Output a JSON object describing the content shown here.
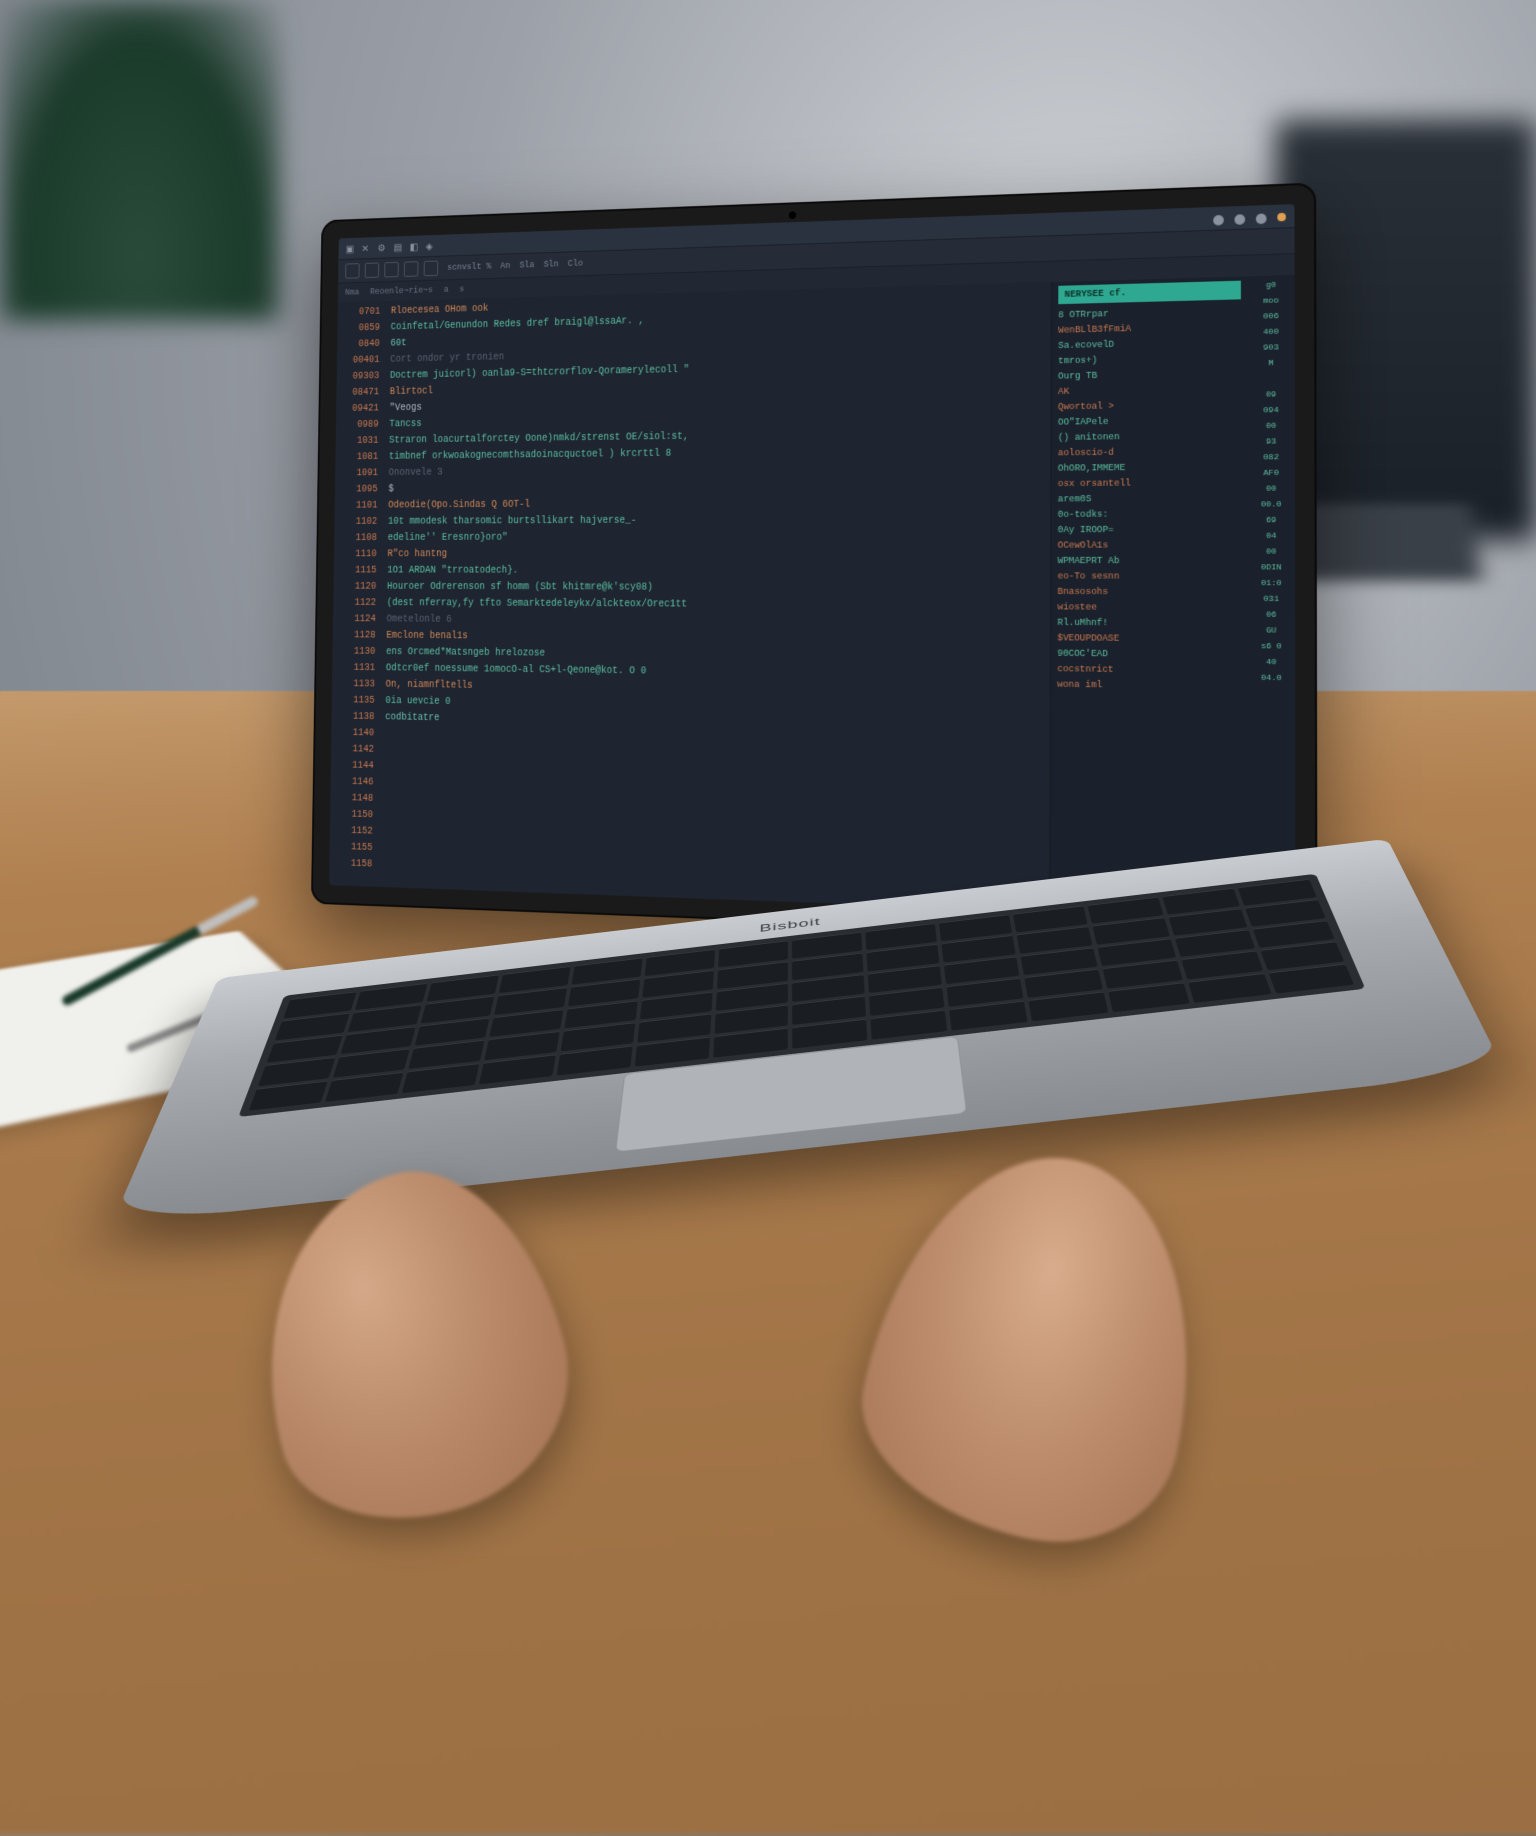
{
  "brand": "Bisboit",
  "titlebar": {
    "icons": [
      "▣",
      "✕",
      "⚙",
      "▤",
      "◧",
      "◈"
    ]
  },
  "toolbar": {
    "buttons": [
      "□",
      "□",
      "□",
      "◫",
      "▭"
    ],
    "label": "scnvslt %",
    "menu": [
      "An",
      "Sla",
      "Sln",
      "Clo"
    ]
  },
  "tabs": [
    "Nma",
    "Reoenle~rie~s",
    "a",
    "s"
  ],
  "gutter": [
    "0701",
    "0859",
    "0840",
    "00401",
    "09303",
    "08471",
    "09421",
    "0989",
    "1031",
    "1081",
    "1091",
    "1095",
    "1101",
    "1102",
    "1108",
    "1110",
    "1115",
    "1120",
    "1122",
    "1124",
    "1128",
    "1130",
    "1131",
    "1133",
    "1135",
    "1138",
    "1140",
    "1142",
    "1144",
    "1146",
    "1148",
    "1150",
    "1152",
    "1155",
    "1158"
  ],
  "code": [
    {
      "t": "Rloecesea OHom ook",
      "c": "kw"
    },
    {
      "t": "Coinfetal/Genundon  Redes dref braigl@lssaAr. ,",
      "c": "str"
    },
    {
      "t": "60t",
      "c": "fn"
    },
    {
      "t": "Cort ondor yr tronien",
      "c": "cm"
    },
    {
      "t": "Doctrem juicorl) oanla9-S=thtcrorflov-Qoramerylecoll \"",
      "c": "str"
    },
    {
      "t": "Blirtocl",
      "c": "kw"
    },
    {
      "t": "  \"Veogs",
      "c": "pl"
    },
    {
      "t": "Tancss",
      "c": "str"
    },
    {
      "t": "Straron loacurtalforctey Oone)nmkd/strenst OE/siol:st,",
      "c": "str"
    },
    {
      "t": "timbnef orkwoakognecomthsadoinacquctoel )   krcrttl 8",
      "c": "str"
    },
    {
      "t": "  Ononvele 3",
      "c": "cm"
    },
    {
      "t": "          $",
      "c": "pl"
    },
    {
      "t": "Odeodie(Opo.Sindas  Q  6OT-l",
      "c": "kw"
    },
    {
      "t": "10t mmodesk tharsomic burtsllikart hajverse_-",
      "c": "str"
    },
    {
      "t": "edeline'' Eresnro}oro\"",
      "c": "str"
    },
    {
      "t": "R\"co hantng",
      "c": "kw"
    },
    {
      "t": "1O1 ARDAN \"trroatodech}.",
      "c": "str"
    },
    {
      "t": " Houroer Odrerenson sf homm (Sbt khitmre@k'scy08)",
      "c": "str"
    },
    {
      "t": "(dest nferray,fy tfto Semarktedeleykx/alckteox/Orec1tt",
      "c": "str"
    },
    {
      "t": "  Ometelonle 6",
      "c": "cm"
    },
    {
      "t": "Emclone benal1s",
      "c": "kw"
    },
    {
      "t": "ens Orcmed*Matsngeb hrelozose",
      "c": "str"
    },
    {
      "t": "Odtcr0ef noessume 1omocO-al  CS+l-Qeone@kot. O  0",
      "c": "str"
    },
    {
      "t": "On, niamnfltells",
      "c": "kw"
    },
    {
      "t": "0ia uevcie  0",
      "c": "str"
    },
    {
      "t": "codbitatre",
      "c": "fn"
    },
    {
      "t": "",
      "c": "pl"
    },
    {
      "t": "",
      "c": "pl"
    },
    {
      "t": "",
      "c": "pl"
    }
  ],
  "panel": {
    "header": "NERYSEE cf.",
    "lines": [
      {
        "t": "8 OTRrpar",
        "c": ""
      },
      {
        "t": "WenBLlB3fFmiA",
        "c": "orange"
      },
      {
        "t": "Sa.ecovelD",
        "c": ""
      },
      {
        "t": "tmros+)",
        "c": ""
      },
      {
        "t": "Ourg TB",
        "c": ""
      },
      {
        "t": "  AK",
        "c": "orange"
      },
      {
        "t": "Qwortoal >",
        "c": "orange"
      },
      {
        "t": "OO\"IAPele",
        "c": ""
      },
      {
        "t": "()  anitonen",
        "c": ""
      },
      {
        "t": "aoloscio-d",
        "c": "orange"
      },
      {
        "t": "OhORO,IMMEME",
        "c": ""
      },
      {
        "t": "osx orsantell",
        "c": "orange"
      },
      {
        "t": "arem0S",
        "c": ""
      },
      {
        "t": "0o-todks:",
        "c": ""
      },
      {
        "t": "0Ay IROOP=",
        "c": ""
      },
      {
        "t": "OCewOlA1s",
        "c": "orange"
      },
      {
        "t": "WPMAEPRT Ab",
        "c": ""
      },
      {
        "t": "eo-To sesnn",
        "c": "orange"
      },
      {
        "t": "Bnasosohs",
        "c": "orange"
      },
      {
        "t": "wiostee",
        "c": "orange"
      },
      {
        "t": "Rl.uMhnf!",
        "c": ""
      },
      {
        "t": "$VEOUPDOASE",
        "c": "orange"
      },
      {
        "t": "90COC'EAD",
        "c": ""
      },
      {
        "t": "cocstnrict",
        "c": "orange"
      },
      {
        "t": "wona iml",
        "c": "orange"
      }
    ],
    "badges": [
      "g0",
      "moo",
      "006",
      "400",
      "903",
      "M",
      "",
      "09",
      "094",
      "00",
      "93",
      "082",
      "AF0",
      "00",
      "00.0",
      "69",
      "04",
      "00",
      "0DIN",
      "01:0",
      "031",
      "06",
      "GU",
      "s6 0",
      "40",
      "04.0"
    ]
  }
}
